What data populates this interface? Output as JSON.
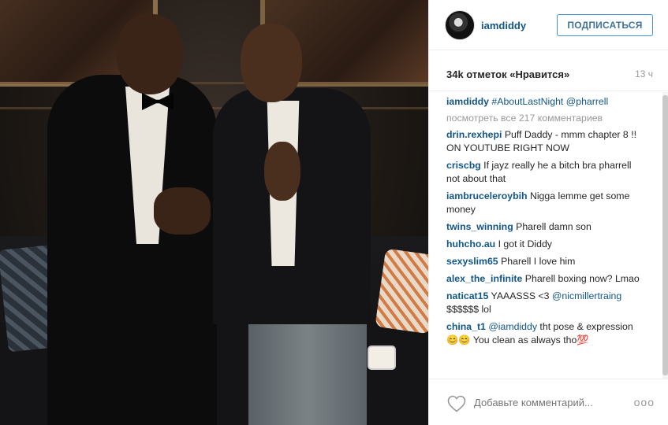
{
  "header": {
    "username": "iamdiddy",
    "follow_label": "ПОДПИСАТЬСЯ"
  },
  "meta": {
    "likes": "34k отметок «Нравится»",
    "time": "13 ч"
  },
  "caption": {
    "user": "iamdiddy",
    "text": "#AboutLastNight @pharrell"
  },
  "view_all": "посмотреть все 217 комментариев",
  "comments": [
    {
      "user": "drin.rexhepi",
      "text": "Puff Daddy - mmm chapter 8 !! ON YOUTUBE RIGHT NOW"
    },
    {
      "user": "criscbg",
      "text": "If jayz really he a bitch bra pharrell not about that"
    },
    {
      "user": "iambruceleroybih",
      "text": "Nigga lemme get some money"
    },
    {
      "user": "twins_winning",
      "text": "Pharell damn son"
    },
    {
      "user": "huhcho.au",
      "text": "I got it Diddy"
    },
    {
      "user": "sexyslim65",
      "text": "Pharell I love him"
    },
    {
      "user": "alex_the_infinite",
      "text": "Pharell boxing now? Lmao"
    },
    {
      "user": "naticat15",
      "text": "YAAASSS <3 ",
      "mention": "@nicmillertraing",
      "after": " $$$$$$ lol"
    },
    {
      "user": "china_t1",
      "text": "",
      "mention": "@iamdiddy",
      "after": " tht pose & expression 😊😊 You clean as always tho💯"
    }
  ],
  "footer": {
    "comment_placeholder": "Добавьте комментарий...",
    "more_label": "ооо"
  },
  "colors": {
    "link": "#125688",
    "follow_border": "#4090db"
  },
  "icons": {
    "like": "heart-outline-icon",
    "more": "more-options-icon"
  }
}
